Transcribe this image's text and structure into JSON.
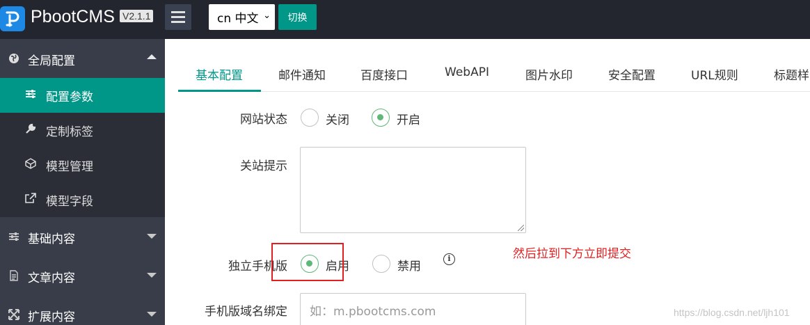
{
  "header": {
    "brand": "PbootCMS",
    "version": "V2.1.1",
    "language_selected": "cn 中文",
    "switch_label": "切换"
  },
  "sidebar": {
    "groups": [
      {
        "label": "全局配置",
        "icon": "globe-icon",
        "expanded": true
      },
      {
        "label": "基础内容",
        "icon": "sliders-icon",
        "expanded": false
      },
      {
        "label": "文章内容",
        "icon": "file-icon",
        "expanded": false
      },
      {
        "label": "扩展内容",
        "icon": "expand-icon",
        "expanded": false
      }
    ],
    "sub_items": [
      {
        "label": "配置参数",
        "icon": "sliders-icon",
        "active": true
      },
      {
        "label": "定制标签",
        "icon": "wrench-icon",
        "active": false
      },
      {
        "label": "模型管理",
        "icon": "cube-icon",
        "active": false
      },
      {
        "label": "模型字段",
        "icon": "external-link-icon",
        "active": false
      }
    ]
  },
  "tabs": [
    "基本配置",
    "邮件通知",
    "百度接口",
    "WebAPI",
    "图片水印",
    "安全配置",
    "URL规则",
    "标题样"
  ],
  "form": {
    "site_status": {
      "label": "网站状态",
      "options": [
        "关闭",
        "开启"
      ],
      "selected": "开启"
    },
    "close_notice": {
      "label": "关站提示",
      "value": ""
    },
    "mobile_version": {
      "label": "独立手机版",
      "options": [
        "启用",
        "禁用"
      ],
      "selected": "启用"
    },
    "mobile_domain": {
      "label": "手机版域名绑定",
      "placeholder": "如：m.pbootcms.com"
    }
  },
  "annotation": "然后拉到下方立即提交",
  "watermark": "https://blog.csdn.net/ljh101",
  "colors": {
    "accent": "#009688",
    "radio_checked": "#5fb878",
    "annotation": "#e02020",
    "header_bg": "#23262e",
    "sidebar_bg": "#393d49"
  }
}
